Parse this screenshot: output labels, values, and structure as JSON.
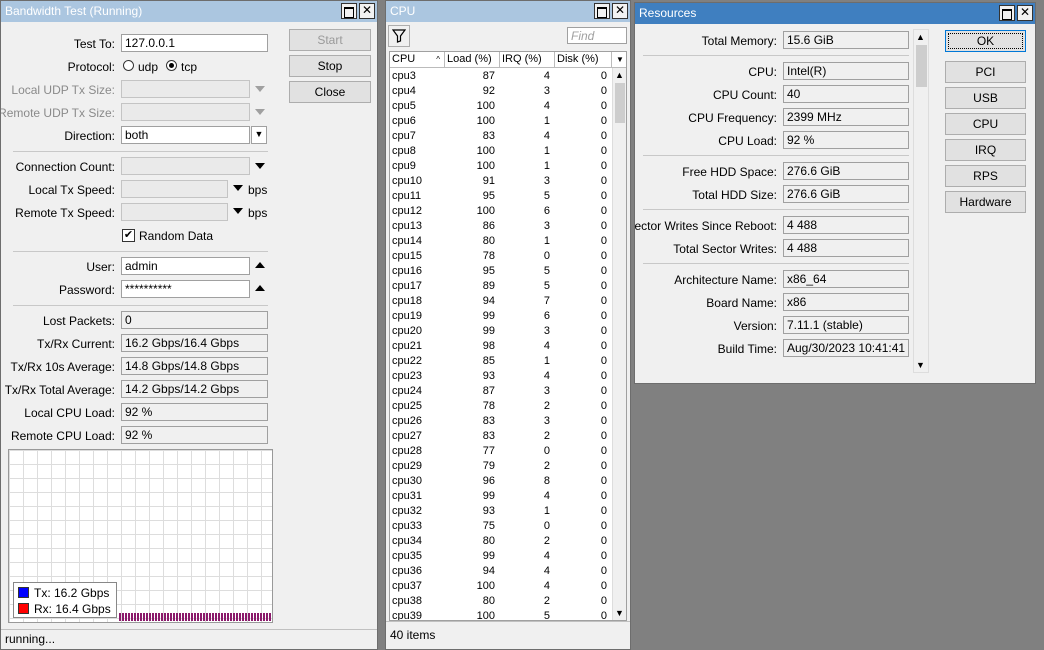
{
  "bw": {
    "title": "Bandwidth Test (Running)",
    "test_to_label": "Test To:",
    "test_to_value": "127.0.0.1",
    "protocol_label": "Protocol:",
    "protocol_udp": "udp",
    "protocol_tcp": "tcp",
    "local_udp_label": "Local UDP Tx Size:",
    "remote_udp_label": "Remote UDP Tx Size:",
    "direction_label": "Direction:",
    "direction_value": "both",
    "conn_count_label": "Connection Count:",
    "local_tx_label": "Local Tx Speed:",
    "remote_tx_label": "Remote Tx Speed:",
    "bps": "bps",
    "random_data_label": "Random Data",
    "user_label": "User:",
    "user_value": "admin",
    "password_label": "Password:",
    "password_value": "**********",
    "lost_packets_label": "Lost Packets:",
    "lost_packets_value": "0",
    "txrx_current_label": "Tx/Rx Current:",
    "txrx_current_value": "16.2 Gbps/16.4 Gbps",
    "txrx_10s_label": "Tx/Rx 10s Average:",
    "txrx_10s_value": "14.8 Gbps/14.8 Gbps",
    "txrx_total_label": "Tx/Rx Total Average:",
    "txrx_total_value": "14.2 Gbps/14.2 Gbps",
    "local_cpu_label": "Local CPU Load:",
    "local_cpu_value": "92 %",
    "remote_cpu_label": "Remote CPU Load:",
    "remote_cpu_value": "92 %",
    "start": "Start",
    "stop": "Stop",
    "close": "Close",
    "legend_tx": "Tx:  16.2 Gbps",
    "legend_rx": "Rx:  16.4 Gbps",
    "tx_color": "#0000ff",
    "rx_color": "#ff0000",
    "bar_color": "#8b1a6b",
    "status": "running..."
  },
  "cpu": {
    "title": "CPU",
    "find_placeholder": "Find",
    "columns": [
      "CPU",
      "Load (%)",
      "IRQ (%)",
      "Disk (%)"
    ],
    "rows": [
      [
        "cpu3",
        "87",
        "4",
        "0"
      ],
      [
        "cpu4",
        "92",
        "3",
        "0"
      ],
      [
        "cpu5",
        "100",
        "4",
        "0"
      ],
      [
        "cpu6",
        "100",
        "1",
        "0"
      ],
      [
        "cpu7",
        "83",
        "4",
        "0"
      ],
      [
        "cpu8",
        "100",
        "1",
        "0"
      ],
      [
        "cpu9",
        "100",
        "1",
        "0"
      ],
      [
        "cpu10",
        "91",
        "3",
        "0"
      ],
      [
        "cpu11",
        "95",
        "5",
        "0"
      ],
      [
        "cpu12",
        "100",
        "6",
        "0"
      ],
      [
        "cpu13",
        "86",
        "3",
        "0"
      ],
      [
        "cpu14",
        "80",
        "1",
        "0"
      ],
      [
        "cpu15",
        "78",
        "0",
        "0"
      ],
      [
        "cpu16",
        "95",
        "5",
        "0"
      ],
      [
        "cpu17",
        "89",
        "5",
        "0"
      ],
      [
        "cpu18",
        "94",
        "7",
        "0"
      ],
      [
        "cpu19",
        "99",
        "6",
        "0"
      ],
      [
        "cpu20",
        "99",
        "3",
        "0"
      ],
      [
        "cpu21",
        "98",
        "4",
        "0"
      ],
      [
        "cpu22",
        "85",
        "1",
        "0"
      ],
      [
        "cpu23",
        "93",
        "4",
        "0"
      ],
      [
        "cpu24",
        "87",
        "3",
        "0"
      ],
      [
        "cpu25",
        "78",
        "2",
        "0"
      ],
      [
        "cpu26",
        "83",
        "3",
        "0"
      ],
      [
        "cpu27",
        "83",
        "2",
        "0"
      ],
      [
        "cpu28",
        "77",
        "0",
        "0"
      ],
      [
        "cpu29",
        "79",
        "2",
        "0"
      ],
      [
        "cpu30",
        "96",
        "8",
        "0"
      ],
      [
        "cpu31",
        "99",
        "4",
        "0"
      ],
      [
        "cpu32",
        "93",
        "1",
        "0"
      ],
      [
        "cpu33",
        "75",
        "0",
        "0"
      ],
      [
        "cpu34",
        "80",
        "2",
        "0"
      ],
      [
        "cpu35",
        "99",
        "4",
        "0"
      ],
      [
        "cpu36",
        "94",
        "4",
        "0"
      ],
      [
        "cpu37",
        "100",
        "4",
        "0"
      ],
      [
        "cpu38",
        "80",
        "2",
        "0"
      ],
      [
        "cpu39",
        "100",
        "5",
        "0"
      ]
    ],
    "footer": "40 items"
  },
  "res": {
    "title": "Resources",
    "total_memory_label": "Total Memory:",
    "total_memory_value": "15.6 GiB",
    "cpu_label": "CPU:",
    "cpu_value": "Intel(R)",
    "cpu_count_label": "CPU Count:",
    "cpu_count_value": "40",
    "cpu_freq_label": "CPU Frequency:",
    "cpu_freq_value": "2399 MHz",
    "cpu_load_label": "CPU Load:",
    "cpu_load_value": "92 %",
    "free_hdd_label": "Free HDD Space:",
    "free_hdd_value": "276.6 GiB",
    "total_hdd_label": "Total HDD Size:",
    "total_hdd_value": "276.6 GiB",
    "sector_writes_label": "Sector Writes Since Reboot:",
    "sector_writes_value": "4 488",
    "total_sector_label": "Total Sector Writes:",
    "total_sector_value": "4 488",
    "arch_label": "Architecture Name:",
    "arch_value": "x86_64",
    "board_label": "Board Name:",
    "board_value": "x86",
    "version_label": "Version:",
    "version_value": "7.11.1 (stable)",
    "build_label": "Build Time:",
    "build_value": "Aug/30/2023 10:41:41",
    "buttons": [
      "OK",
      "PCI",
      "USB",
      "CPU",
      "IRQ",
      "RPS",
      "Hardware"
    ]
  }
}
